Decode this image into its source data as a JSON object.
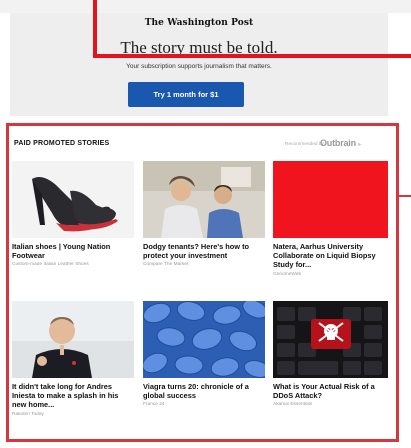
{
  "subscription": {
    "masthead": "The Washington Post",
    "tagline": "The story must be told.",
    "support_text": "Your subscription supports journalism that matters.",
    "cta_label": "Try 1 month for $1"
  },
  "promoted": {
    "header": "PAID PROMOTED STORIES",
    "recommended_by": "Recommended by",
    "provider": "Outbrain",
    "cards": [
      {
        "title": "Italian shoes | Young Nation Footwear",
        "source": "Custom-made Italian Leather Shoes"
      },
      {
        "title": "Dodgy tenants? Here's how to protect your investment",
        "source": "Compare The Market"
      },
      {
        "title": "Natera, Aarhus University Collaborate on Liquid Biopsy Study for...",
        "source": "GenomeWeb"
      },
      {
        "title": "It didn't take long for Andres Iniesta to make a splash in his new home...",
        "source": "Rakuten Today"
      },
      {
        "title": "Viagra turns 20: chronicle of a global success",
        "source": "France 24"
      },
      {
        "title": "What is Your Actual Risk of a DDoS Attack?",
        "source": "Akamai Essentials"
      }
    ]
  },
  "colors": {
    "annotation_red": "#e3141b",
    "cta_blue": "#1a58b0",
    "red_thumb": "#f0141e"
  }
}
